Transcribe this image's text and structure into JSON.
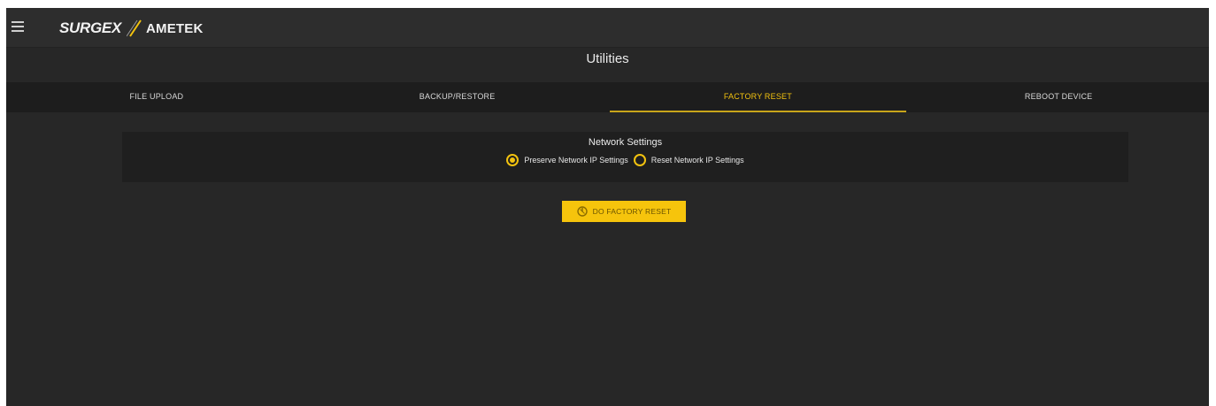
{
  "brand": {
    "primary": "SURGEX",
    "secondary": "AMETEK",
    "accent_color": "#f2c20f"
  },
  "header": {
    "menu_icon": "hamburger-icon"
  },
  "page": {
    "title": "Utilities"
  },
  "tabs": [
    {
      "label": "FILE UPLOAD",
      "active": false
    },
    {
      "label": "BACKUP/RESTORE",
      "active": false
    },
    {
      "label": "FACTORY RESET",
      "active": true
    },
    {
      "label": "REBOOT DEVICE",
      "active": false
    }
  ],
  "network_settings": {
    "title": "Network Settings",
    "options": [
      {
        "label": "Preserve Network IP Settings",
        "selected": true
      },
      {
        "label": "Reset Network IP Settings",
        "selected": false
      }
    ]
  },
  "factory_reset_button": {
    "label": "DO FACTORY RESET",
    "icon": "power-reset-icon"
  }
}
